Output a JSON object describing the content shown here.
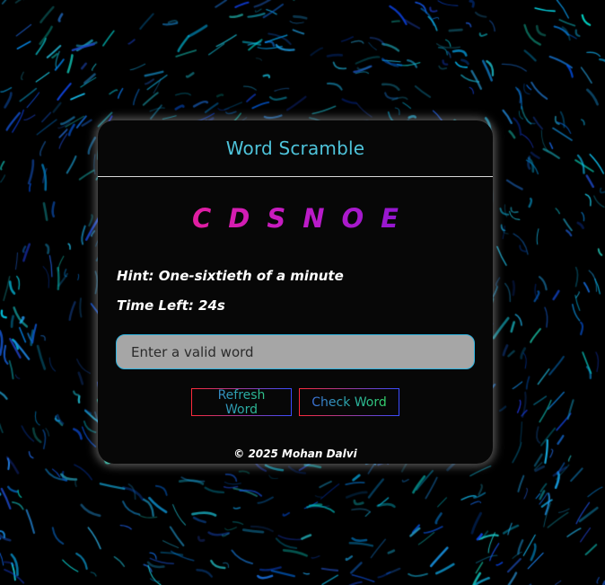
{
  "app": {
    "title": "Word Scramble"
  },
  "game": {
    "scrambled_word": "CDSNOE",
    "hint": "Hint: One-sixtieth of a minute",
    "time_left": "Time Left: 24s"
  },
  "input": {
    "placeholder": "Enter a valid word",
    "value": ""
  },
  "buttons": {
    "refresh_label": "Refresh Word",
    "check_label": "Check Word"
  },
  "footer": {
    "text": "© 2025 Mohan Dalvi"
  },
  "colors": {
    "title": "#4ec3da",
    "card_background": "#070707",
    "input_background": "#a6a6a6",
    "input_border": "#2fb4e0",
    "letters_gradient_start": "#ff1f7d",
    "letters_gradient_end": "#6a12d8"
  }
}
